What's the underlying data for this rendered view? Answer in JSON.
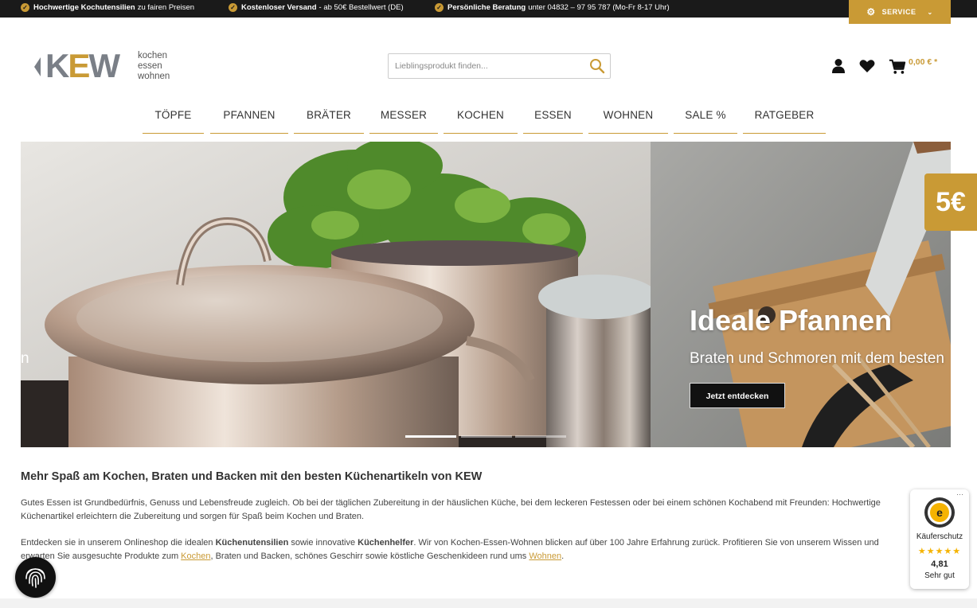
{
  "topbar": {
    "usps": [
      {
        "bold": "Hochwertige Kochutensilien",
        "text": "zu fairen Preisen"
      },
      {
        "bold": "Kostenloser Versand",
        "text": "- ab 50€ Bestellwert (DE)"
      },
      {
        "bold": "Persönliche Beratung",
        "text": "unter 04832 – 97 95 787 (Mo-Fr 8-17 Uhr)"
      }
    ],
    "service_label": "SERVICE"
  },
  "header": {
    "logo_text": "KEW",
    "logo_sub": [
      "kochen",
      "essen",
      "wohnen"
    ],
    "search_placeholder": "Lieblingsprodukt finden...",
    "cart_total": "0,00 € *"
  },
  "nav": {
    "items": [
      "TÖPFE",
      "PFANNEN",
      "BRÄTER",
      "MESSER",
      "KOCHEN",
      "ESSEN",
      "WOHNEN",
      "SALE %",
      "RATGEBER"
    ]
  },
  "hero": {
    "title": "Ideale Pfannen",
    "subtitle": "Braten und Schmoren mit dem besten",
    "cta": "Jetzt entdecken",
    "left_fragment": "n",
    "slide_count": 3,
    "active_slide": 1
  },
  "promo_badge": "5€",
  "content": {
    "title": "Mehr Spaß am Kochen, Braten und Backen mit den besten Küchenartikeln von KEW",
    "p1": "Gutes Essen ist Grundbedürfnis, Genuss und Lebensfreude zugleich. Ob bei der täglichen Zubereitung in der häuslichen Küche, bei dem leckeren Festessen oder bei einem schönen Kochabend mit Freunden: Hochwertige Küchenartikel erleichtern die Zubereitung und sorgen für Spaß beim Kochen und Braten.",
    "p2_a": "Entdecken sie in unserem Onlineshop die idealen ",
    "p2_b": "Küchenutensilien",
    "p2_c": " sowie innovative ",
    "p2_d": "Küchenhelfer",
    "p2_e": ". Wir von Kochen-Essen-Wohnen blicken auf über 100 Jahre Erfahrung zurück. Profitieren Sie von unserem Wissen und erwarten Sie ausgesuchte Produkte zum ",
    "p2_link1": "Kochen",
    "p2_f": ", Braten und Backen, schönes Geschirr sowie köstliche Geschenkideen rund ums ",
    "p2_link2": "Wohnen",
    "p2_g": "."
  },
  "trust": {
    "more": "···",
    "label": "Käuferschutz",
    "stars": "★★★★★",
    "score": "4,81",
    "grade": "Sehr gut"
  },
  "colors": {
    "accent": "#c99a35",
    "topbar": "#1a1a1a"
  }
}
